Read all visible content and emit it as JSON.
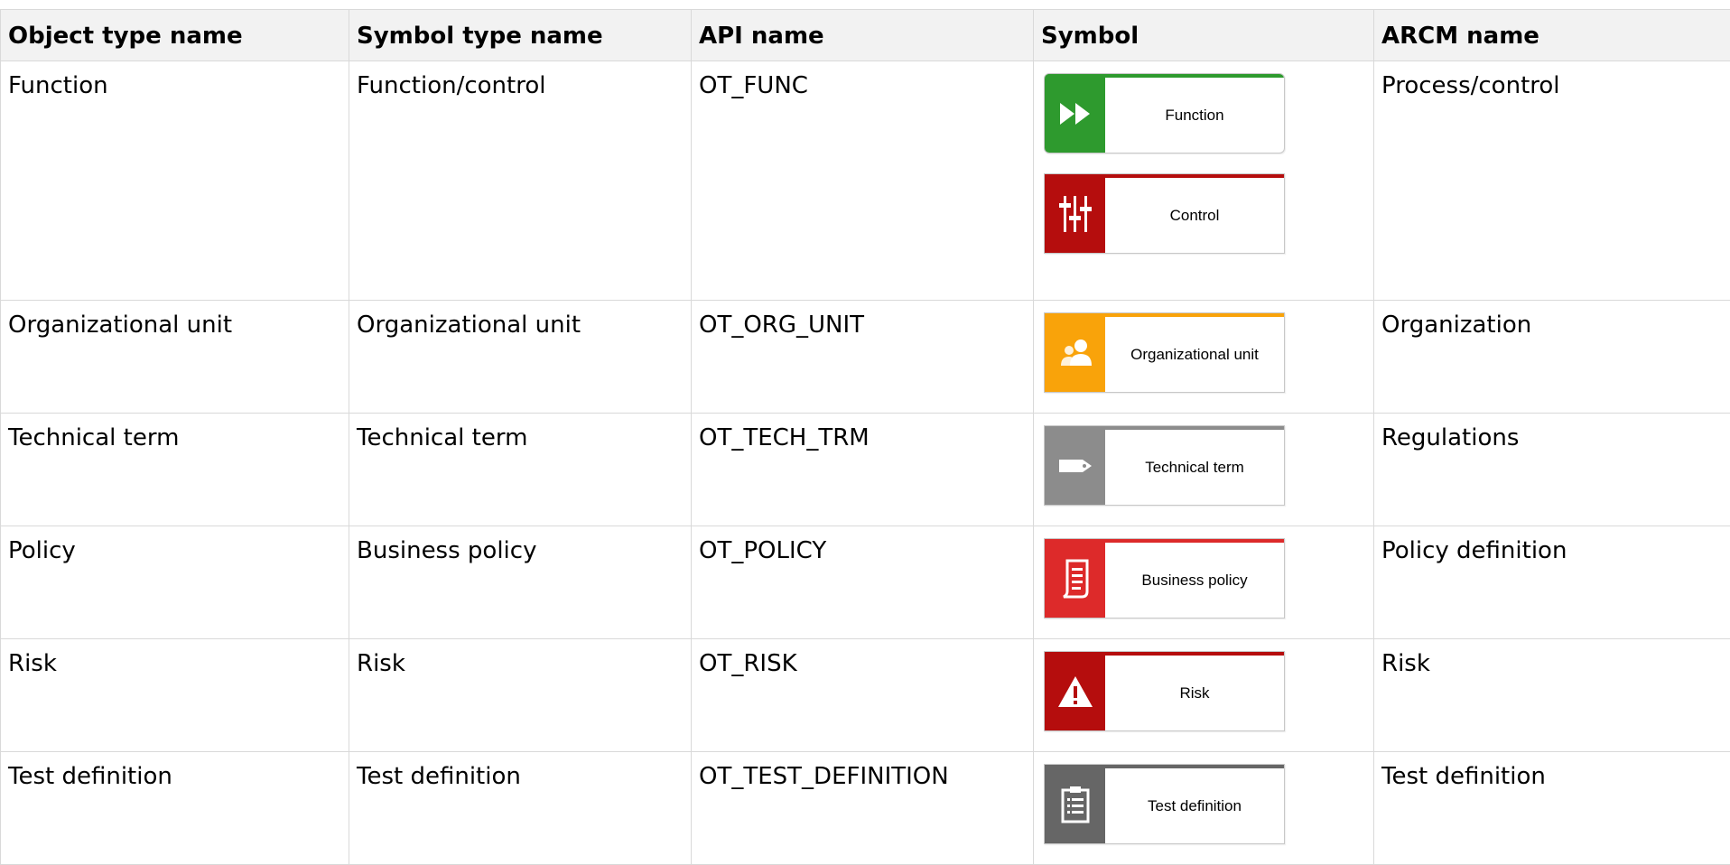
{
  "headers": [
    "Object type name",
    "Symbol type name",
    "API name",
    "Symbol",
    "ARCM name"
  ],
  "rows": [
    {
      "object_type": "Function",
      "symbol_type": "Function/control",
      "api_name": "OT_FUNC",
      "symbols": [
        {
          "label": "Function",
          "color": "#2e9a2e",
          "icon": "fast-forward-icon"
        },
        {
          "label": "Control",
          "color": "#b50d0d",
          "icon": "sliders-icon"
        }
      ],
      "arcm_name": "Process/control"
    },
    {
      "object_type": "Organizational unit",
      "symbol_type": "Organizational unit",
      "api_name": "OT_ORG_UNIT",
      "symbols": [
        {
          "label": "Organizational unit",
          "color": "#f9a30a",
          "icon": "people-icon"
        }
      ],
      "arcm_name": "Organization"
    },
    {
      "object_type": "Technical term",
      "symbol_type": "Technical term",
      "api_name": "OT_TECH_TRM",
      "symbols": [
        {
          "label": "Technical term",
          "color": "#8c8c8c",
          "icon": "tag-icon"
        }
      ],
      "arcm_name": "Regulations"
    },
    {
      "object_type": "Policy",
      "symbol_type": "Business policy",
      "api_name": "OT_POLICY",
      "symbols": [
        {
          "label": "Business policy",
          "color": "#dd2a2a",
          "icon": "scroll-icon"
        }
      ],
      "arcm_name": "Policy definition"
    },
    {
      "object_type": "Risk",
      "symbol_type": "Risk",
      "api_name": "OT_RISK",
      "symbols": [
        {
          "label": "Risk",
          "color": "#b50d0d",
          "icon": "warning-icon"
        }
      ],
      "arcm_name": "Risk"
    },
    {
      "object_type": "Test definition",
      "symbol_type": "Test definition",
      "api_name": "OT_TEST_DEFINITION",
      "symbols": [
        {
          "label": "Test definition",
          "color": "#666666",
          "icon": "clipboard-icon"
        }
      ],
      "arcm_name": "Test definition"
    }
  ]
}
